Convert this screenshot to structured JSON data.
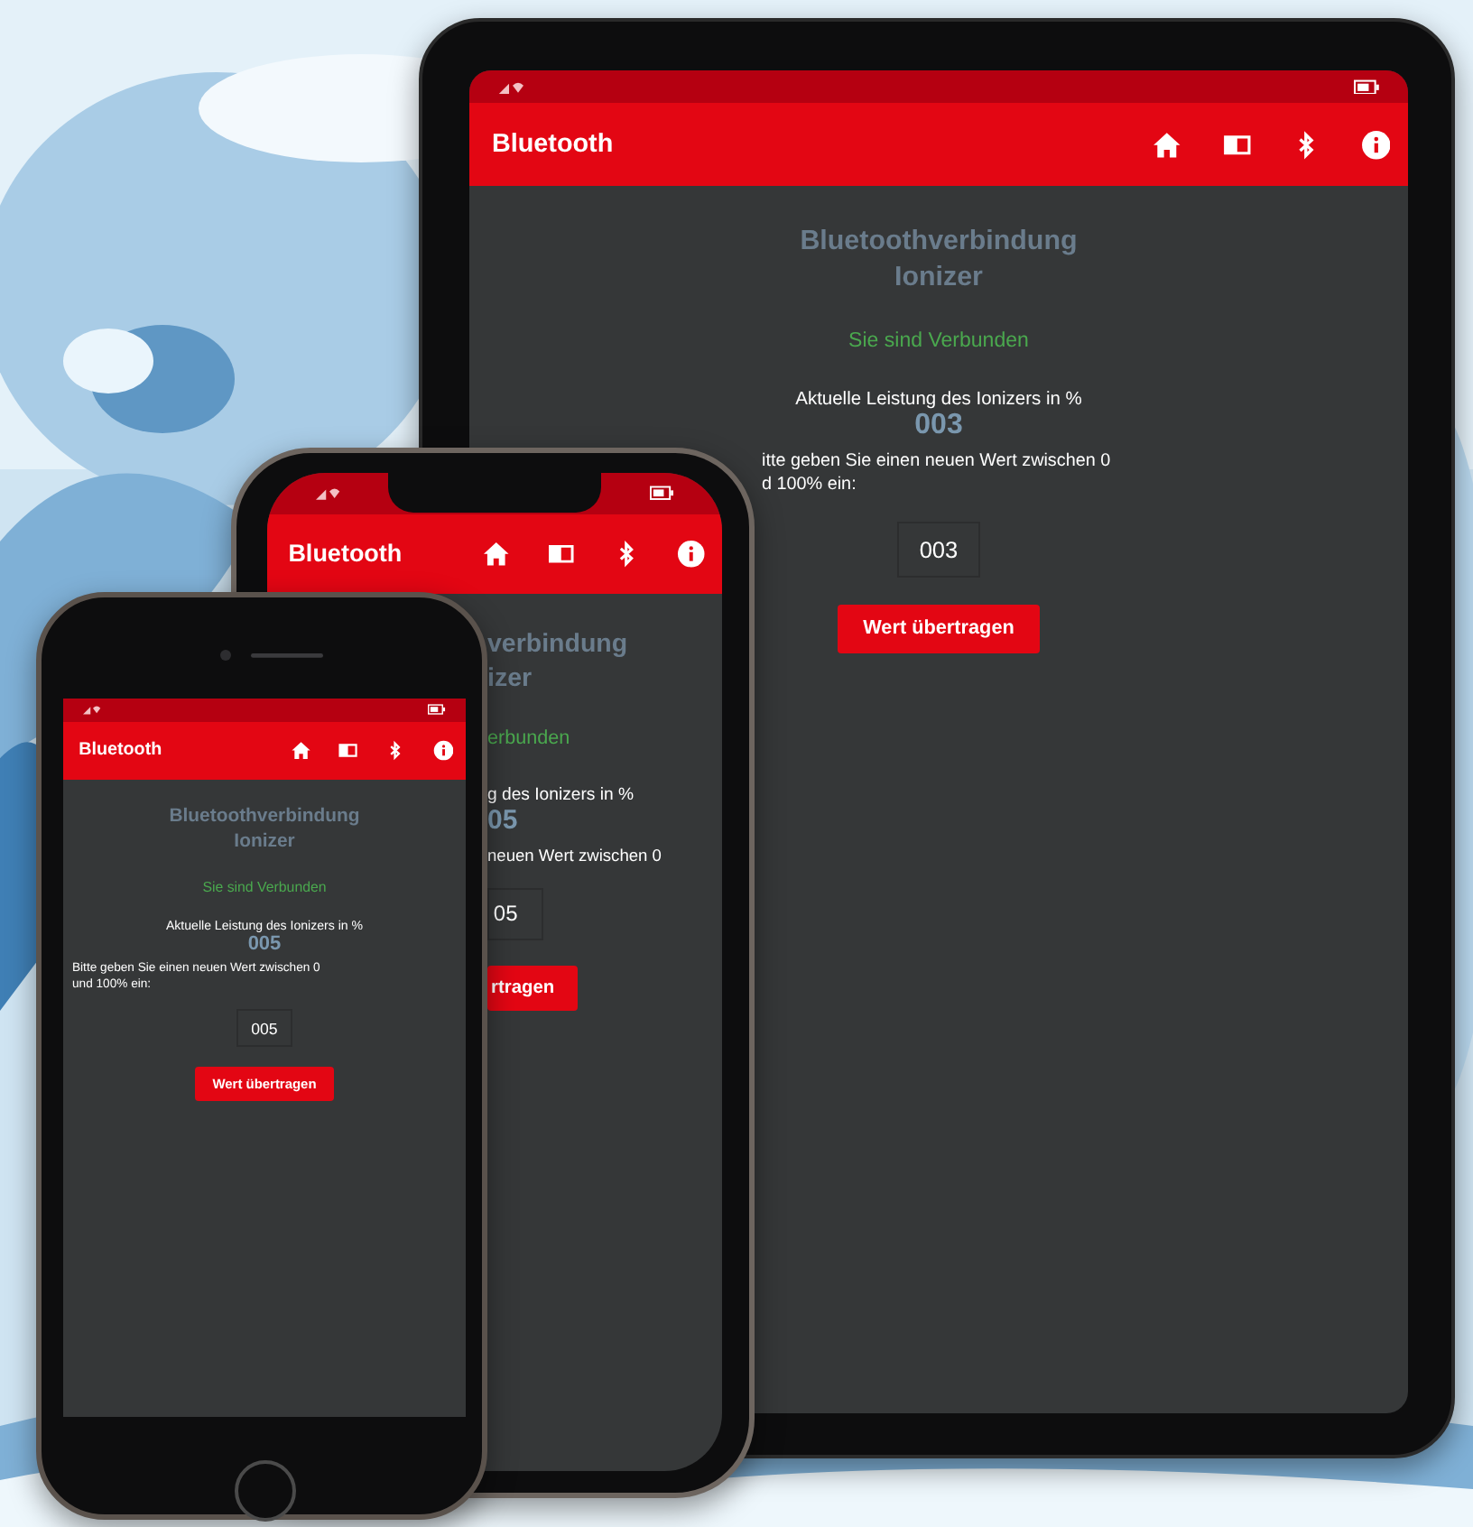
{
  "devices": [
    {
      "kind": "tablet",
      "app_bar": {
        "title": "Bluetooth"
      },
      "heading_lines": [
        "Bluetoothverbindung",
        "Ionizer"
      ],
      "status": "Sie sind Verbunden",
      "power_label": "Aktuelle Leistung des Ionizers in %",
      "power_value": "003",
      "prompt_lines": [
        "itte geben Sie einen neuen Wert zwischen 0",
        "d 100% ein:"
      ],
      "input_value": "003",
      "submit_button": "Wert übertragen"
    },
    {
      "kind": "notch-phone",
      "app_bar": {
        "title": "Bluetooth"
      },
      "heading_lines": [
        "verbindung",
        "izer"
      ],
      "status": "erbunden",
      "power_label": "g des Ionizers in %",
      "power_value": "05",
      "prompt_lines": [
        "neuen Wert zwischen 0"
      ],
      "input_value": "05",
      "submit_button": "rtragen"
    },
    {
      "kind": "home-phone",
      "app_bar": {
        "title": "Bluetooth"
      },
      "heading_lines": [
        "Bluetoothverbindung",
        "Ionizer"
      ],
      "status": "Sie sind Verbunden",
      "power_label": "Aktuelle Leistung des Ionizers in %",
      "power_value": "005",
      "prompt_lines": [
        "Bitte geben Sie einen neuen Wert zwischen 0",
        "und 100% ein:"
      ],
      "input_value": "005",
      "submit_button": "Wert übertragen"
    }
  ]
}
